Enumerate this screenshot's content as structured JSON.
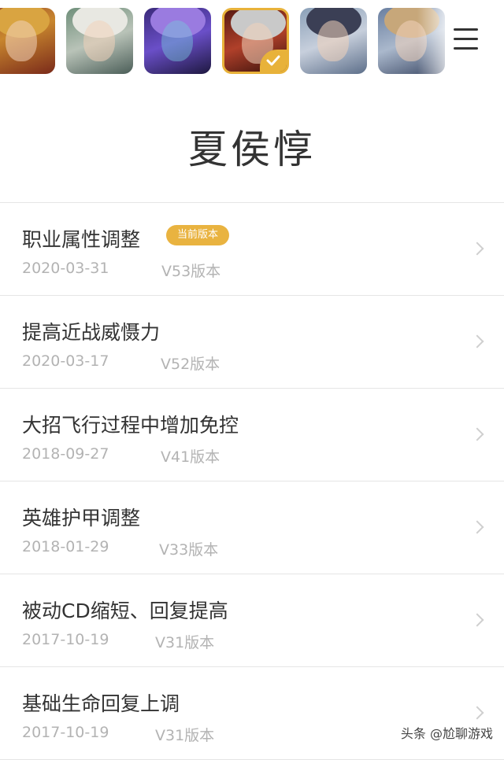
{
  "colors": {
    "accent": "#e9b340",
    "text": "#333333",
    "muted": "#b3b3b3",
    "divider": "#e5e5e5"
  },
  "hero_bar": {
    "avatars": [
      {
        "name": "hero-avatar-1",
        "selected": false
      },
      {
        "name": "hero-avatar-2",
        "selected": false
      },
      {
        "name": "hero-avatar-3",
        "selected": false
      },
      {
        "name": "hero-avatar-4",
        "selected": true
      },
      {
        "name": "hero-avatar-5",
        "selected": false
      },
      {
        "name": "hero-avatar-6",
        "selected": false
      }
    ],
    "menu_icon": "hamburger-menu-icon"
  },
  "page": {
    "title": "夏侯惇"
  },
  "changes": [
    {
      "title": "职业属性调整",
      "date": "2020-03-31",
      "version": "V53版本",
      "badge": "当前版本"
    },
    {
      "title": "提高近战威慑力",
      "date": "2020-03-17",
      "version": "V52版本"
    },
    {
      "title": "大招飞行过程中增加免控",
      "date": "2018-09-27",
      "version": "V41版本"
    },
    {
      "title": "英雄护甲调整",
      "date": "2018-01-29",
      "version": "V33版本"
    },
    {
      "title": "被动CD缩短、回复提高",
      "date": "2017-10-19",
      "version": "V31版本"
    },
    {
      "title": "基础生命回复上调",
      "date": "2017-10-19",
      "version": "V31版本"
    }
  ],
  "watermark": "头条 @尬聊游戏"
}
